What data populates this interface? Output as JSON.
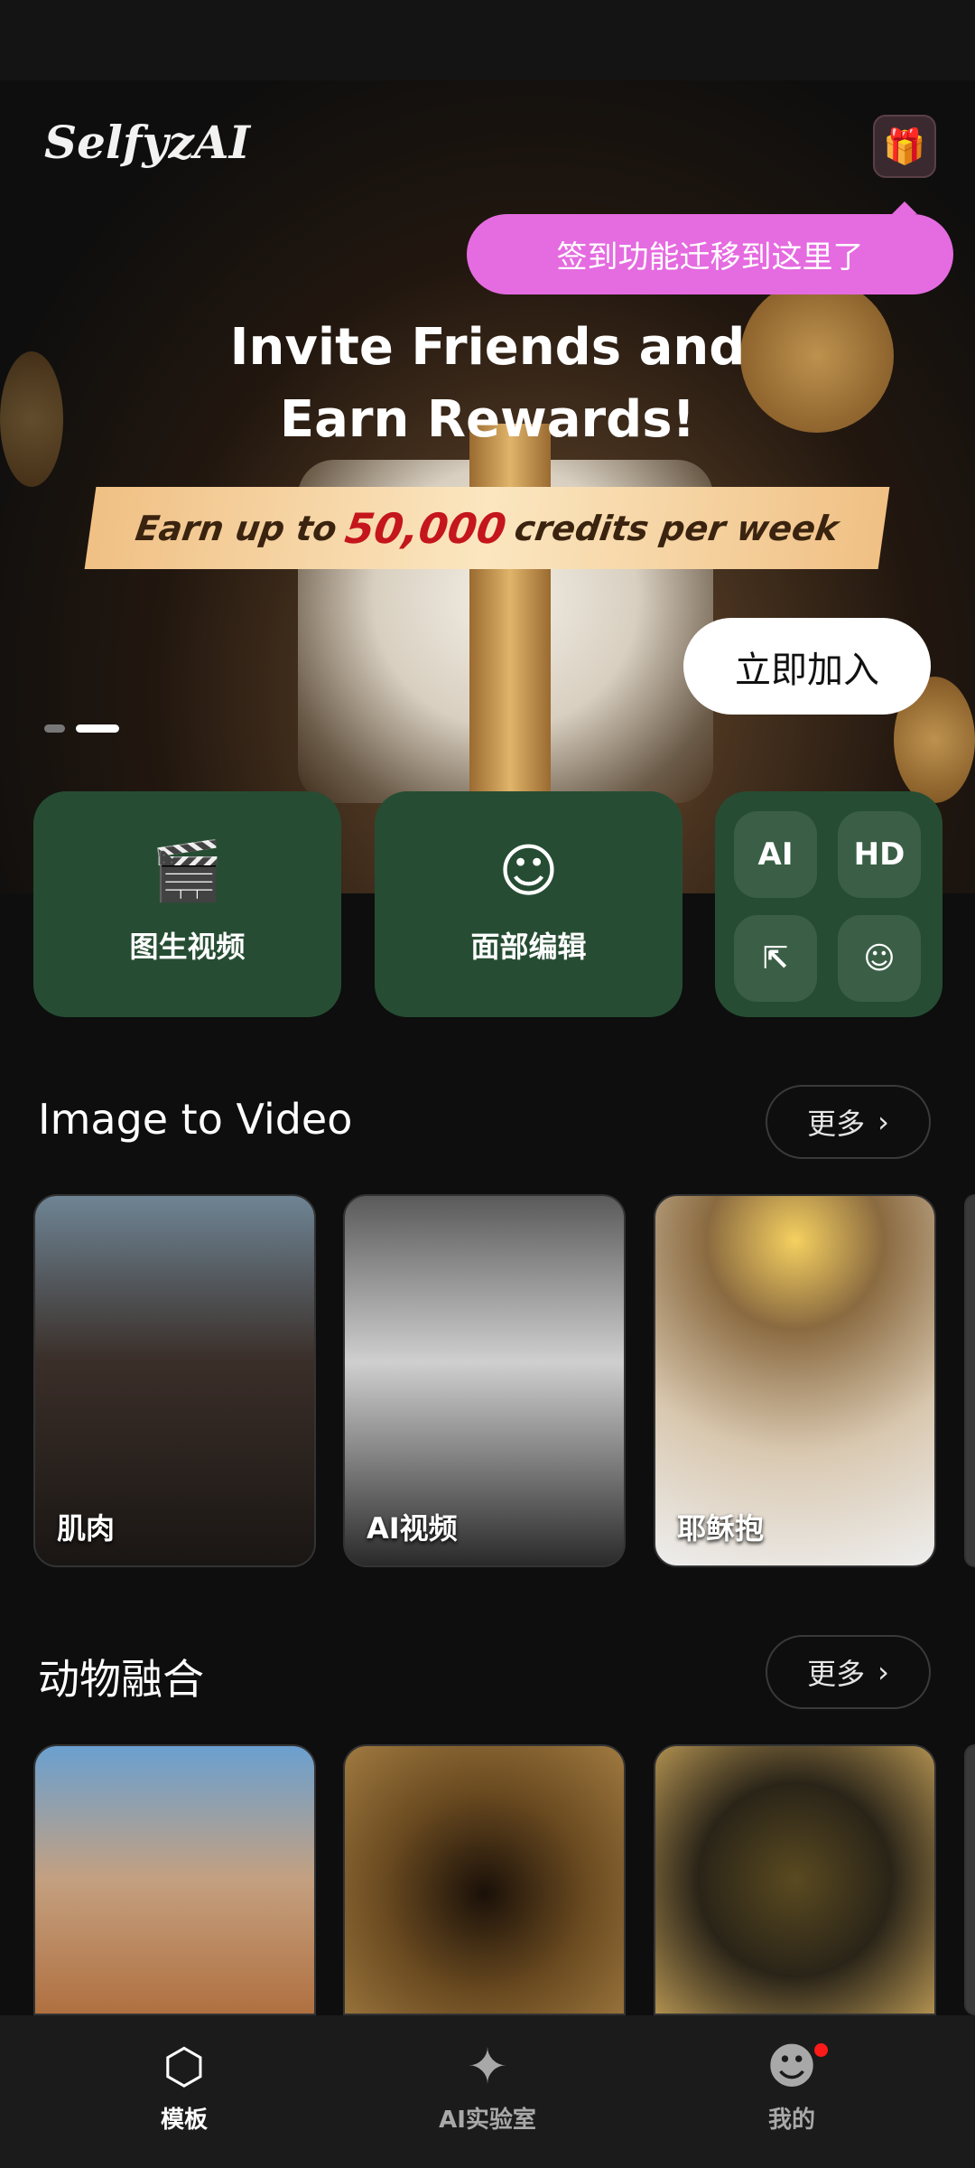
{
  "header": {
    "logo": "SelfyzAI",
    "gift_icon": "gift-icon"
  },
  "tooltip": "签到功能迁移到这里了",
  "banner": {
    "title_line1": "Invite Friends and",
    "title_line2": "Earn Rewards!",
    "strip_prefix": "Earn up to",
    "strip_amount": "50,000",
    "strip_suffix": "credits per week",
    "cta": "立即加入",
    "active_slide": 2,
    "slide_count": 2
  },
  "features": [
    {
      "label": "图生视频",
      "icon": "ai-video-icon"
    },
    {
      "label": "面部编辑",
      "icon": "face-edit-icon"
    }
  ],
  "mini_tools": [
    {
      "icon": "ai-image-icon",
      "text": "AI"
    },
    {
      "icon": "hd-icon",
      "text": "HD"
    },
    {
      "icon": "expand-icon",
      "text": "⇱"
    },
    {
      "icon": "baby-face-icon",
      "text": "☺"
    }
  ],
  "sections": [
    {
      "title": "Image to Video",
      "more": "更多",
      "items": [
        {
          "label": "肌肉"
        },
        {
          "label": "AI视频"
        },
        {
          "label": "耶稣抱"
        }
      ]
    },
    {
      "title": "动物融合",
      "more": "更多",
      "items": [
        {
          "label": ""
        },
        {
          "label": ""
        },
        {
          "label": ""
        }
      ]
    }
  ],
  "nav": [
    {
      "label": "模板",
      "icon": "template-icon",
      "active": true
    },
    {
      "label": "AI实验室",
      "icon": "ai-lab-icon",
      "active": false
    },
    {
      "label": "我的",
      "icon": "profile-icon",
      "active": false,
      "badge": true
    }
  ],
  "colors": {
    "card_green": "#264d33",
    "tooltip_pink": "#e56be0",
    "badge_red": "#ff1a1a"
  }
}
